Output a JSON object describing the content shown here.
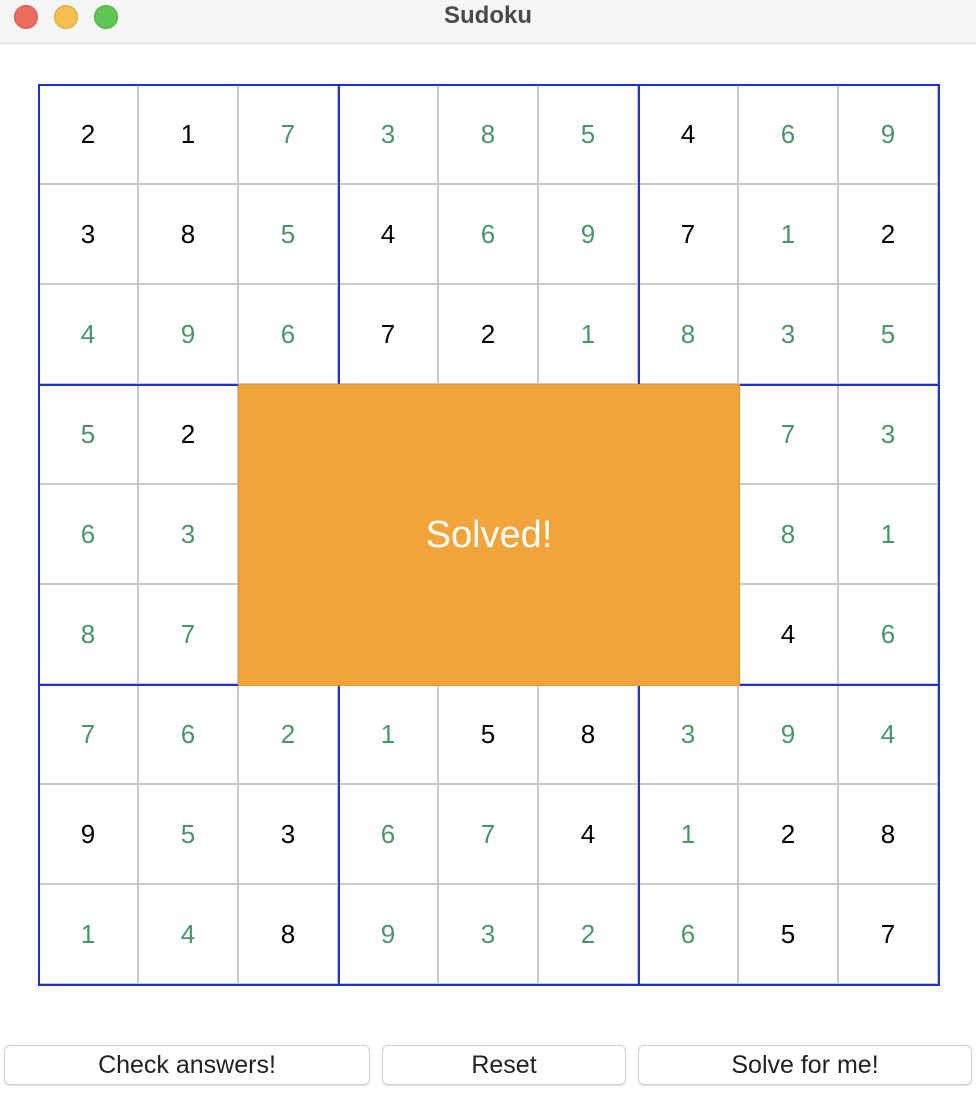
{
  "window": {
    "title": "Sudoku"
  },
  "colors": {
    "given_digit": "#000000",
    "solved_digit": "#4a9469",
    "box_border": "#1a33d6",
    "cell_border": "#c8c8c8",
    "overlay_bg": "#f2a33a",
    "close": "#ec6a5e",
    "minimize": "#f4bf4f",
    "maximize": "#61c554"
  },
  "board": {
    "rows": [
      [
        "2",
        "1",
        "7",
        "3",
        "8",
        "5",
        "4",
        "6",
        "9"
      ],
      [
        "3",
        "8",
        "5",
        "4",
        "6",
        "9",
        "7",
        "1",
        "2"
      ],
      [
        "4",
        "9",
        "6",
        "7",
        "2",
        "1",
        "8",
        "3",
        "5"
      ],
      [
        "5",
        "2",
        "",
        "",
        "",
        "",
        "",
        "7",
        "3"
      ],
      [
        "6",
        "3",
        "",
        "",
        "",
        "",
        "",
        "8",
        "1"
      ],
      [
        "8",
        "7",
        "",
        "",
        "",
        "",
        "",
        "4",
        "6"
      ],
      [
        "7",
        "6",
        "2",
        "1",
        "5",
        "8",
        "3",
        "9",
        "4"
      ],
      [
        "9",
        "5",
        "3",
        "6",
        "7",
        "4",
        "1",
        "2",
        "8"
      ],
      [
        "1",
        "4",
        "8",
        "9",
        "3",
        "2",
        "6",
        "5",
        "7"
      ]
    ],
    "given": [
      [
        1,
        1,
        0,
        0,
        0,
        0,
        1,
        0,
        0
      ],
      [
        1,
        1,
        0,
        1,
        0,
        0,
        1,
        0,
        1
      ],
      [
        0,
        0,
        0,
        1,
        1,
        0,
        0,
        0,
        0
      ],
      [
        0,
        1,
        0,
        0,
        0,
        0,
        0,
        0,
        0
      ],
      [
        0,
        0,
        0,
        0,
        0,
        0,
        0,
        0,
        0
      ],
      [
        0,
        0,
        0,
        0,
        0,
        0,
        0,
        1,
        0
      ],
      [
        0,
        0,
        0,
        0,
        1,
        1,
        0,
        0,
        0
      ],
      [
        1,
        0,
        1,
        0,
        0,
        1,
        0,
        1,
        1
      ],
      [
        0,
        0,
        1,
        0,
        0,
        0,
        0,
        1,
        1
      ]
    ]
  },
  "overlay": {
    "text": "Solved!"
  },
  "buttons": {
    "check": "Check answers!",
    "reset": "Reset",
    "solve": "Solve for me!"
  }
}
